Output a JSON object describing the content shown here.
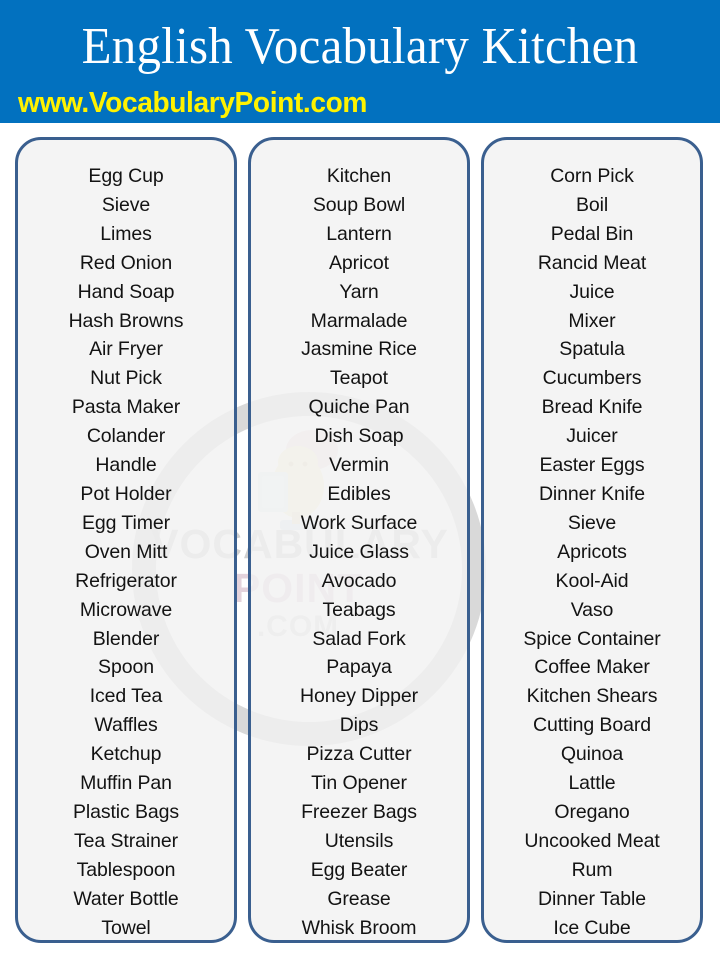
{
  "header": {
    "title": "English Vocabulary Kitchen",
    "url": "www.VocabularyPoint.com",
    "background_color": "#0271bf",
    "title_color": "#ffffff",
    "url_color": "#fff200"
  },
  "watermark": {
    "line1": "VOCABULARY",
    "line2": "POINT",
    "line3": ".COM",
    "color": "#cccccc"
  },
  "card_style": {
    "border_color": "#3a5f8f",
    "fill_color": "#f2f2f2",
    "text_color": "#131313"
  },
  "columns": [
    {
      "index": 1,
      "words": [
        "Egg Cup",
        "Sieve",
        "Limes",
        "Red Onion",
        "Hand Soap",
        "Hash Browns",
        "Air Fryer",
        "Nut Pick",
        "Pasta Maker",
        "Colander",
        "Handle",
        "Pot Holder",
        "Egg Timer",
        "Oven Mitt",
        "Refrigerator",
        "Microwave",
        "Blender",
        "Spoon",
        "Iced Tea",
        "Waffles",
        "Ketchup",
        "Muffin Pan",
        "Plastic Bags",
        "Tea Strainer",
        "Tablespoon",
        "Water Bottle",
        "Towel"
      ]
    },
    {
      "index": 2,
      "words": [
        "Kitchen",
        "Soup Bowl",
        "Lantern",
        "Apricot",
        "Yarn",
        "Marmalade",
        "Jasmine Rice",
        "Teapot",
        "Quiche Pan",
        "Dish Soap",
        "Vermin",
        "Edibles",
        "Work Surface",
        "Juice Glass",
        "Avocado",
        "Teabags",
        "Salad Fork",
        "Papaya",
        "Honey Dipper",
        "Dips",
        "Pizza Cutter",
        "Tin Opener",
        "Freezer Bags",
        "Utensils",
        "Egg Beater",
        "Grease",
        "Whisk Broom"
      ]
    },
    {
      "index": 3,
      "words": [
        "Corn Pick",
        "Boil",
        "Pedal Bin",
        "Rancid Meat",
        "Juice",
        "Mixer",
        "Spatula",
        "Cucumbers",
        "Bread Knife",
        "Juicer",
        "Easter Eggs",
        "Dinner Knife",
        "Sieve",
        "Apricots",
        "Kool-Aid",
        "Vaso",
        "Spice Container",
        "Coffee Maker",
        "Kitchen Shears",
        "Cutting Board",
        "Quinoa",
        "Lattle",
        "Oregano",
        "Uncooked Meat",
        "Rum",
        "Dinner Table",
        "Ice Cube"
      ]
    }
  ]
}
